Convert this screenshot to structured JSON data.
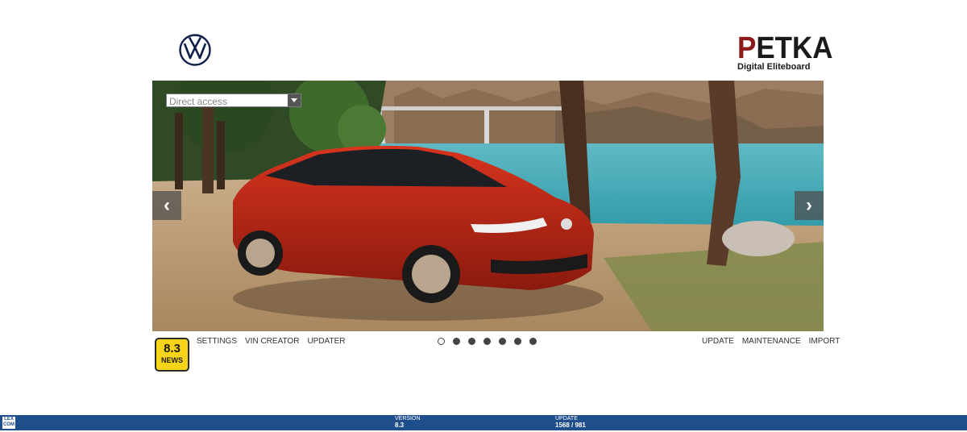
{
  "header": {
    "brand_logo": "vw-logo",
    "petka_title_p": "P",
    "petka_title_rest": "ETKA",
    "petka_subtitle": "Digital Eliteboard"
  },
  "search": {
    "placeholder": "Direct access"
  },
  "carousel": {
    "prev_icon": "chevron-left-icon",
    "next_icon": "chevron-right-icon",
    "prev_glyph": "‹",
    "next_glyph": "›",
    "active_index": 0,
    "dot_count": 7
  },
  "news": {
    "version": "8.3",
    "label": "NEWS"
  },
  "nav_left": {
    "settings": "SETTINGS",
    "vin_creator": "VIN CREATOR",
    "updater": "UPDATER"
  },
  "nav_right": {
    "update": "UPDATE",
    "maintenance": "MAINTENANCE",
    "import": "IMPORT"
  },
  "footer": {
    "logo_line1": "LEX",
    "logo_line2": "COM",
    "version_label": "VERSION",
    "version_value": "8.3",
    "update_label": "UPDATE",
    "update_value": "1568 / 981"
  },
  "colors": {
    "footer_bg": "#1f4e8c",
    "news_bg": "#f7d417",
    "petka_accent": "#8c1a1a",
    "vw_blue": "#0f1e4a"
  }
}
